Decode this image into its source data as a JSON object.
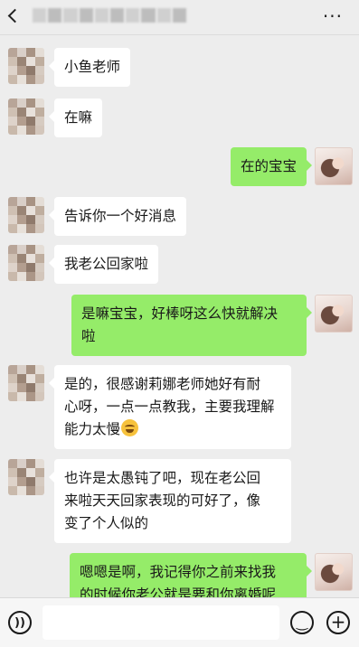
{
  "messages": [
    {
      "side": "left",
      "text": "小鱼老师"
    },
    {
      "side": "left",
      "text": "在嘛"
    },
    {
      "side": "right",
      "text": "在的宝宝"
    },
    {
      "side": "left",
      "text": "告诉你一个好消息"
    },
    {
      "side": "left",
      "text": "我老公回家啦"
    },
    {
      "side": "right",
      "line1": "是嘛宝宝，好棒呀这么快就解决",
      "line2": "啦"
    },
    {
      "side": "left",
      "line1": "是的，很感谢莉娜老师她好有耐",
      "line2": "心呀，一点一点教我，主要我理解",
      "line3": "能力太慢",
      "emoji": "laugh-cry-emoji"
    },
    {
      "side": "left",
      "line1": "也许是太愚钝了吧，现在老公回",
      "line2": "来啦天天回家表现的可好了，像",
      "line3": "变了个人似的"
    },
    {
      "side": "right",
      "line1": "嗯嗯是啊，我记得你之前来找我",
      "line2": "的时候你老公就是要和你离婚呢"
    }
  ],
  "header": {
    "more_label": "···"
  },
  "input": {
    "placeholder": ""
  },
  "toolbar": {
    "voice_icon": "voice-icon",
    "emoji_icon": "emoji-icon",
    "plus_icon": "plus-icon"
  }
}
